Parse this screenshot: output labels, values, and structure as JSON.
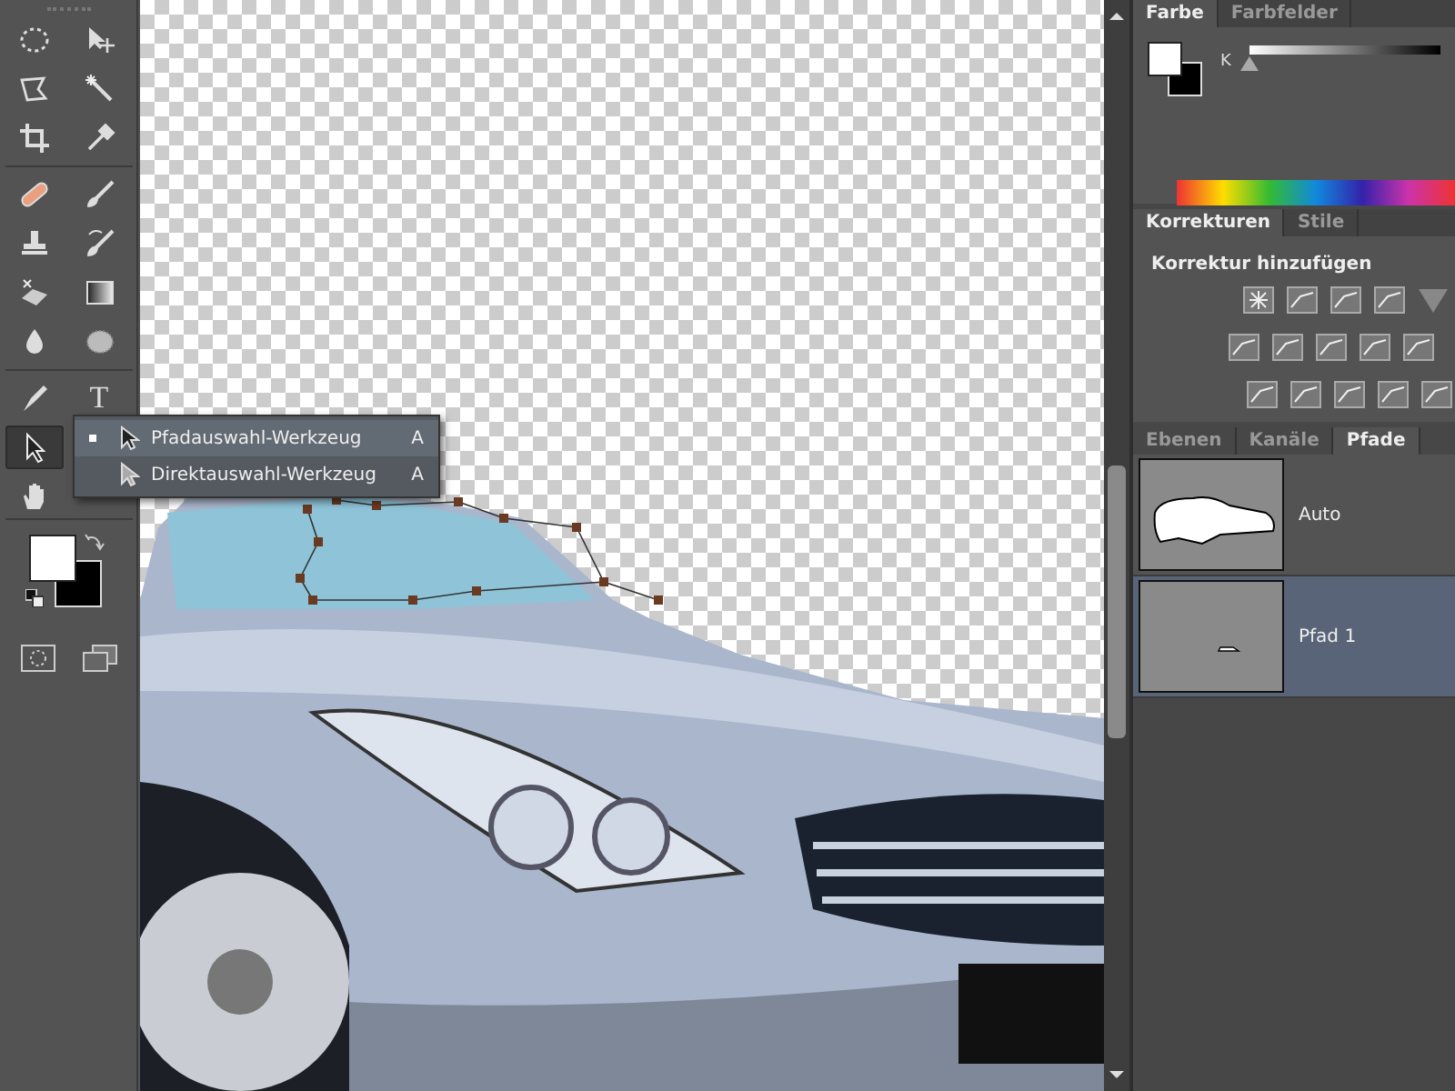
{
  "toolbar": {
    "tools": [
      {
        "selected": false
      },
      {
        "selected": false
      },
      {
        "selected": false
      },
      {
        "selected": false
      },
      {
        "selected": false
      },
      {
        "selected": false
      },
      {
        "selected": false
      },
      {
        "selected": false
      },
      {
        "selected": false
      },
      {
        "selected": false
      },
      {
        "selected": false
      },
      {
        "selected": false
      },
      {
        "selected": false
      },
      {
        "selected": false
      },
      {
        "selected": false
      },
      {
        "selected": false,
        "label": "T"
      },
      {
        "selected": true
      },
      {
        "selected": false
      }
    ]
  },
  "flyout": {
    "items": [
      {
        "label": "Pfadauswahl-Werkzeug",
        "shortcut": "A",
        "selected": true
      },
      {
        "label": "Direktauswahl-Werkzeug",
        "shortcut": "A",
        "selected": false
      }
    ]
  },
  "color_panel": {
    "tabs": [
      {
        "label": "Farbe",
        "selected": true
      },
      {
        "label": "Farbfelder",
        "selected": false
      }
    ],
    "channel": "K",
    "level": 0
  },
  "adjustments_panel": {
    "tabs": [
      {
        "label": "Korrekturen",
        "selected": true
      },
      {
        "label": "Stile",
        "selected": false
      }
    ],
    "heading": "Korrektur hinzufügen"
  },
  "paths_panel": {
    "tabs": [
      {
        "label": "Ebenen",
        "selected": false
      },
      {
        "label": "Kanäle",
        "selected": false
      },
      {
        "label": "Pfade",
        "selected": true
      }
    ],
    "paths": [
      {
        "name": "Auto",
        "selected": false,
        "kind": "car"
      },
      {
        "name": "Pfad 1",
        "selected": true,
        "kind": "small"
      }
    ]
  }
}
